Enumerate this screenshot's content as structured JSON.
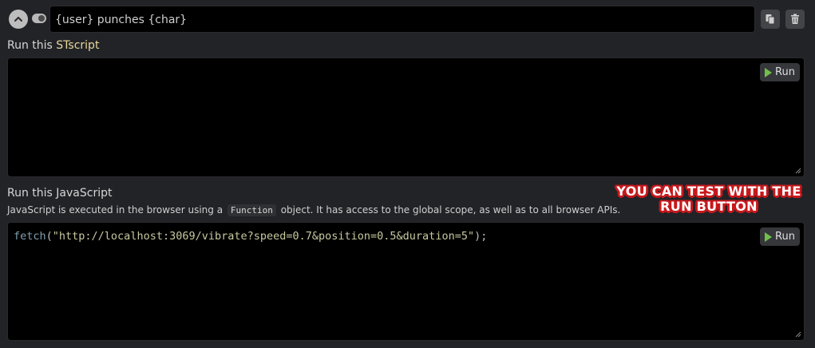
{
  "trigger": {
    "value": "{user} punches {char}"
  },
  "stscript": {
    "label_prefix": "Run this ",
    "label_accent": "STscript",
    "run_label": "Run"
  },
  "javascript": {
    "label": "Run this JavaScript",
    "desc_before": "JavaScript is executed in the browser using a",
    "desc_code": "Function",
    "desc_after": "object. It has access to the global scope, as well as to all browser APIs.",
    "code_fn": "fetch",
    "code_open": "(",
    "code_string": "\"http://localhost:3069/vibrate?speed=0.7&position=0.5&duration=5\"",
    "code_close": ");",
    "run_label": "Run"
  },
  "annotation": {
    "line1": "YOU CAN TEST WITH THE",
    "line2": "RUN BUTTON"
  },
  "colors": {
    "background": "#222327",
    "editor": "#000000",
    "accent_text": "#e8d79a",
    "play_icon": "#6fbf4a",
    "annotation_outline": "#c8191c"
  },
  "icons": [
    "chevron-up-icon",
    "toggle-icon",
    "copy-icon",
    "trash-icon",
    "play-icon",
    "resize-grip-icon"
  ]
}
